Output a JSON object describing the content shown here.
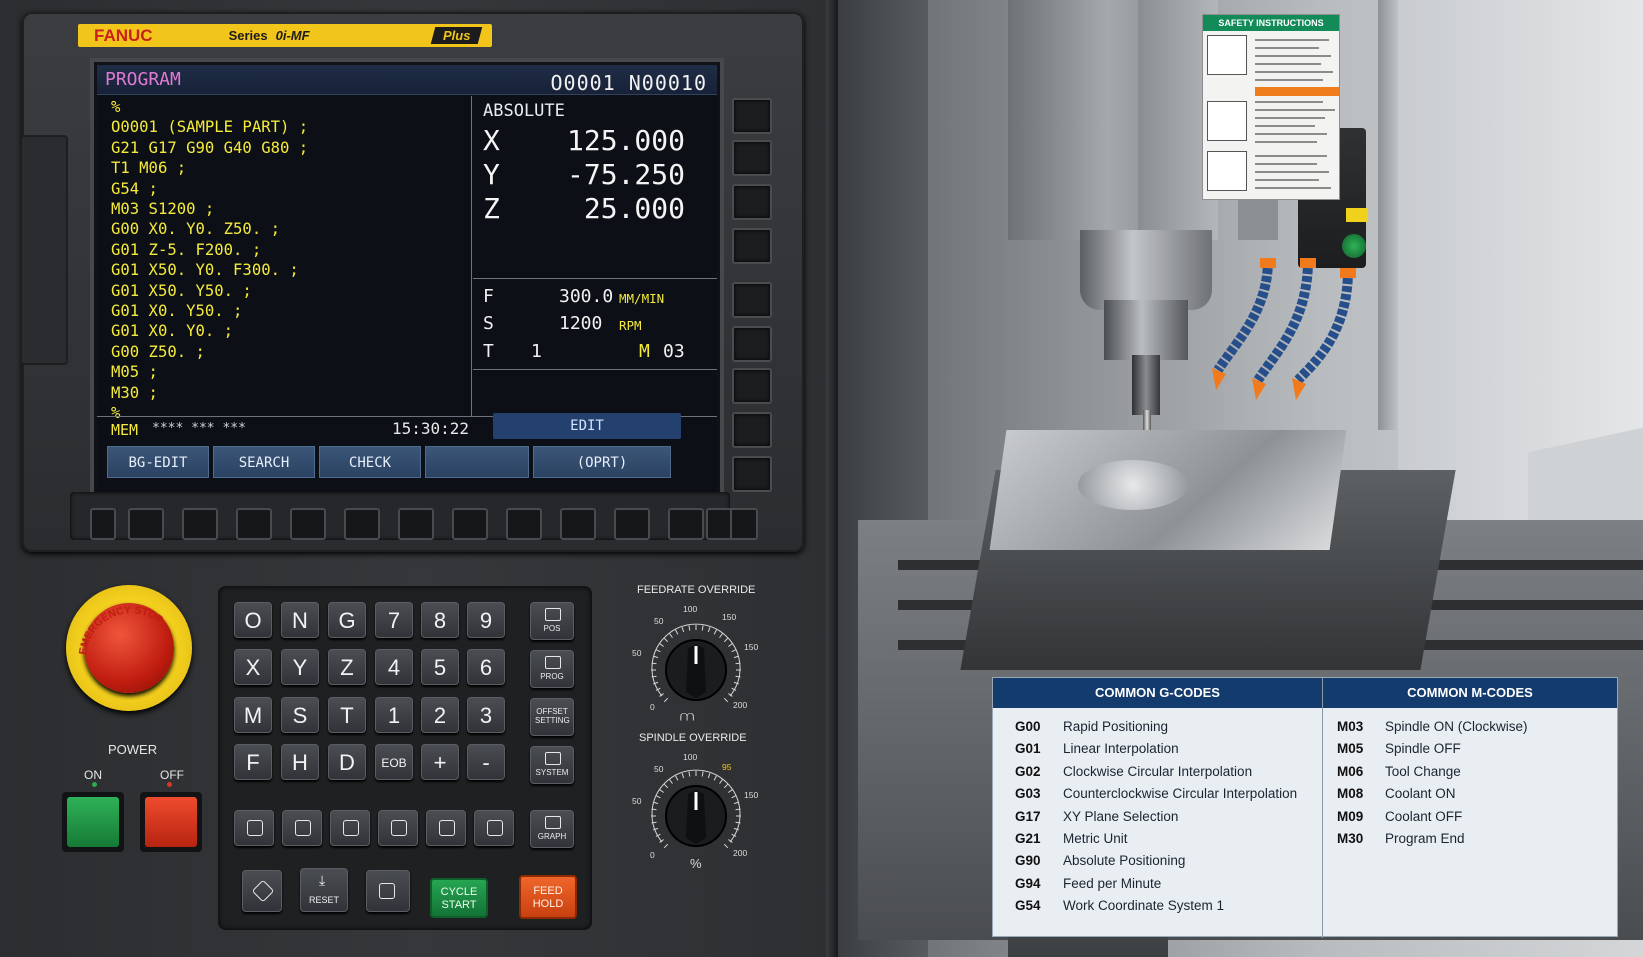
{
  "brand": {
    "maker": "FANUC",
    "series": "Series",
    "model": "0i-MF",
    "plus": "Plus"
  },
  "screen": {
    "mode_title": "PROGRAM",
    "program_id": "O0001 N00010",
    "code_lines": [
      "%",
      "O0001 (SAMPLE PART) ;",
      "G21 G17 G90 G40 G80 ;",
      "T1 M06 ;",
      "G54 ;",
      "M03 S1200 ;",
      "G00 X0. Y0. Z50. ;",
      "G01 Z-5. F200. ;",
      "G01 X50. Y0. F300. ;",
      "G01 X50. Y50. ;",
      "G01 X0. Y50. ;",
      "G01 X0. Y0. ;",
      "G00 Z50. ;",
      "M05 ;",
      "M30 ;",
      "%"
    ],
    "position_title": "ABSOLUTE",
    "axes": [
      {
        "label": "X",
        "value": "125.000"
      },
      {
        "label": "Y",
        "value": "-75.250"
      },
      {
        "label": "Z",
        "value": "25.000"
      }
    ],
    "feed": {
      "label": "F",
      "value": "300.0",
      "unit": "MM/MIN"
    },
    "spindle": {
      "label": "S",
      "value": "1200",
      "unit": "RPM"
    },
    "tool": {
      "label": "T",
      "value": "1"
    },
    "mcode": {
      "label": "M",
      "value": "03"
    },
    "status": {
      "mem": "MEM",
      "stars": "**** *** ***",
      "time": "15:30:22",
      "mode": "EDIT"
    },
    "softkeys": [
      "BG-EDIT",
      "SEARCH",
      "CHECK",
      "",
      "(OPRT)"
    ]
  },
  "estop": {
    "label": "EMERGENCY STOP"
  },
  "power": {
    "label": "POWER",
    "on": "ON",
    "off": "OFF"
  },
  "keypad": {
    "rows": [
      [
        "O",
        "N",
        "G",
        "7",
        "8",
        "9"
      ],
      [
        "X",
        "Y",
        "Z",
        "4",
        "5",
        "6"
      ],
      [
        "M",
        "S",
        "T",
        "1",
        "2",
        "3"
      ],
      [
        "F",
        "H",
        "D",
        "EOB",
        "+",
        "-"
      ]
    ],
    "function_keys": [
      "POS",
      "PROG",
      "OFFSET SETTING",
      "SYSTEM",
      "GRAPH"
    ],
    "reset_label": "RESET",
    "cycle_start": "CYCLE START",
    "feed_hold": "FEED HOLD"
  },
  "feedrate_override": {
    "title": "FEEDRATE OVERRIDE",
    "ticks": [
      "0",
      "50",
      "50",
      "100",
      "150",
      "150",
      "200"
    ],
    "unit": "⩋"
  },
  "spindle_override": {
    "title": "SPINDLE OVERRIDE",
    "ticks": [
      "0",
      "50",
      "50",
      "100",
      "95",
      "150",
      "200"
    ],
    "unit": "%"
  },
  "safety_label": {
    "title": "SAFETY INSTRUCTIONS"
  },
  "reference": {
    "g_title": "COMMON G-CODES",
    "m_title": "COMMON M-CODES",
    "g_codes": [
      {
        "code": "G00",
        "desc": "Rapid Positioning"
      },
      {
        "code": "G01",
        "desc": "Linear Interpolation"
      },
      {
        "code": "G02",
        "desc": "Clockwise Circular Interpolation"
      },
      {
        "code": "G03",
        "desc": "Counterclockwise Circular Interpolation"
      },
      {
        "code": "G17",
        "desc": "XY Plane Selection"
      },
      {
        "code": "G21",
        "desc": "Metric Unit"
      },
      {
        "code": "G90",
        "desc": "Absolute Positioning"
      },
      {
        "code": "G94",
        "desc": "Feed per Minute"
      },
      {
        "code": "G54",
        "desc": "Work Coordinate System 1"
      }
    ],
    "m_codes": [
      {
        "code": "M03",
        "desc": "Spindle ON (Clockwise)"
      },
      {
        "code": "M05",
        "desc": "Spindle OFF"
      },
      {
        "code": "M06",
        "desc": "Tool Change"
      },
      {
        "code": "M08",
        "desc": "Coolant ON"
      },
      {
        "code": "M09",
        "desc": "Coolant OFF"
      },
      {
        "code": "M30",
        "desc": "Program End"
      }
    ]
  }
}
